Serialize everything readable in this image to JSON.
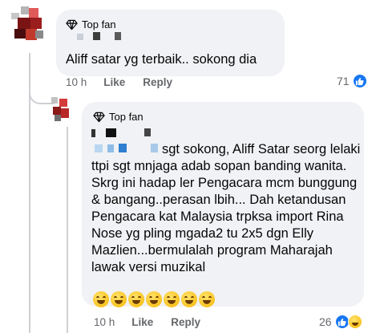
{
  "comment": {
    "badge": "Top fan",
    "text": "Aliff satar yg terbaik.. sokong dia",
    "time": "10 h",
    "like_label": "Like",
    "reply_label": "Reply",
    "reaction_count": "71",
    "reaction_icon": "like-icon"
  },
  "reply": {
    "badge": "Top fan",
    "text": "sgt sokong, Aliff Satar seorg lelaki ttpi sgt mnjaga adab sopan banding wanita. Skrg ini hadap ler Pengacara mcm bunggung & bangang..perasan lbih... Dah ketandusan Pengacara kat Malaysia trpksa import Rina Nose yg pling mgada2 tu 2x5 dgn Elly Mazlien...bermulalah program Maharajah lawak versi muzikal",
    "emoji_count": 7,
    "emoji_icon": "rofl-emoji-icon",
    "time": "10 h",
    "like_label": "Like",
    "reply_label": "Reply",
    "reaction_count": "26",
    "reaction_icons": [
      "haha-icon",
      "like-icon"
    ]
  },
  "colors": {
    "bubble": "#f0f2f5",
    "meta_text": "#65676b",
    "like_blue": "#1877f2",
    "thread_line": "#ced0d4"
  }
}
